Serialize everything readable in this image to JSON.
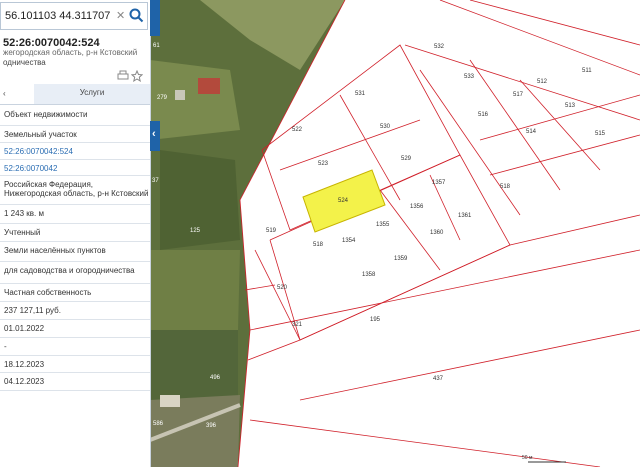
{
  "search": {
    "value": "56.101103 44.311707",
    "clear_label": "✕"
  },
  "collapse": {
    "label": "‹"
  },
  "parcel": {
    "cadastral_number": "52:26:0070042:524",
    "address_short": "жегородская область, р-н Кстовский",
    "purpose_short": "одничества"
  },
  "tabs": {
    "first": "‹",
    "services": "Услуги"
  },
  "rows": [
    {
      "text": "Объект недвижимости",
      "link": false
    },
    {
      "text": "Земельный участок",
      "link": false
    },
    {
      "text": "52:26:0070042:524",
      "link": true
    },
    {
      "text": "52:26:0070042",
      "link": true
    },
    {
      "text": "Российская Федерация, Нижегородская область, р-н Кстовский",
      "link": false
    },
    {
      "text": "1 243 кв. м",
      "link": false
    },
    {
      "text": "Учтенный",
      "link": false
    },
    {
      "text": "Земли населённых пунктов",
      "link": false
    },
    {
      "text": "для садоводства и огородничества",
      "link": false
    },
    {
      "text": "Частная собственность",
      "link": false
    },
    {
      "text": "237 127,11 руб.",
      "link": false
    },
    {
      "text": "01.01.2022",
      "link": false
    },
    {
      "text": "-",
      "link": false
    },
    {
      "text": "18.12.2023",
      "link": false
    },
    {
      "text": "04.12.2023",
      "link": false
    }
  ],
  "map": {
    "parcels": [
      "531",
      "522",
      "530",
      "523",
      "529",
      "524",
      "1357",
      "1356",
      "1361",
      "519",
      "518",
      "1354",
      "1355",
      "1360",
      "1359",
      "1358",
      "520",
      "321",
      "195",
      "437",
      "532",
      "533",
      "512",
      "517",
      "513",
      "516",
      "514",
      "515",
      "518",
      "511"
    ],
    "aerial_labels": [
      "61",
      "279",
      "37",
      "125",
      "496",
      "396",
      "586"
    ],
    "scale_label": "50 м",
    "highlight_color": "#f3f24a",
    "boundary_color": "#d0202a"
  }
}
